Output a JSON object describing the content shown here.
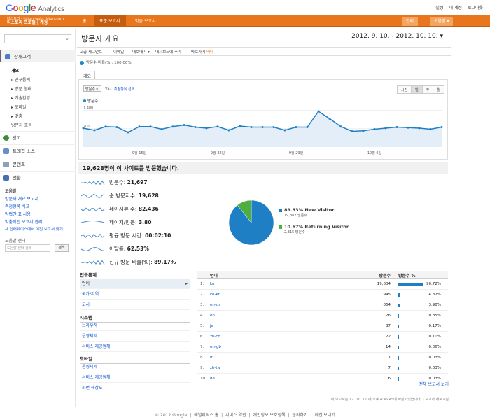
{
  "app": {
    "logo_google": "Google",
    "logo_analytics": "Analytics",
    "top_links": [
      "설정",
      "내 계정",
      "로그아웃"
    ]
  },
  "nav": {
    "account_line1": "티스토리 - tistory-abbi.tistory.com",
    "account_line2": "티스토리 프로필 | 계정",
    "tabs": [
      "홈",
      "표준 보고서",
      "맞춤 보고서"
    ],
    "right_buttons": [
      "관리",
      "도움말 ▾"
    ]
  },
  "sidebar": {
    "search_placeholder": "",
    "sections": [
      {
        "label": "잠재고객",
        "icon": "audience-icon"
      },
      {
        "label": "광고",
        "icon": "advertising-icon"
      },
      {
        "label": "트래픽 소스",
        "icon": "traffic-icon"
      },
      {
        "label": "콘텐츠",
        "icon": "content-icon"
      },
      {
        "label": "전환",
        "icon": "conversion-icon"
      }
    ],
    "audience_sub": [
      "개요",
      "▸ 인구통계",
      "▸ 방문 형태",
      "▸ 기술환경",
      "▸ 모바일",
      "▸ 맞춤",
      "방문자 흐름"
    ],
    "help_title": "도움말",
    "help_links": [
      "방문자 개요 보고서",
      "측정항목 비교",
      "방법안 표 사용",
      "맞춤적인 보고서 관리",
      "새 인터페이스에서 이전 보고서 찾기"
    ],
    "help_center": "도움말 센터",
    "help_search_placeholder": "도움말 센터 검색",
    "help_search_btn": "검색"
  },
  "main": {
    "title": "방문자 개요",
    "date_range": "2012. 9. 10. - 2012. 10. 10.",
    "toolbar": [
      "고급 세그먼트",
      "이메일",
      "내보내기 ▾",
      "대시보드에 추가",
      "바로가기"
    ],
    "toolbar_beta": "베타",
    "segment": "방문수 비율(%): 100.00%",
    "tab": "개요",
    "metric_select": "방문수 ▾",
    "vs": "VS.",
    "add_metric": "측정항목 선택",
    "time_buttons": [
      "시간",
      "일",
      "주",
      "월"
    ],
    "chart_legend": "방문수"
  },
  "chart_data": {
    "type": "area",
    "series": [
      {
        "name": "방문수",
        "values": [
          720,
          640,
          780,
          760,
          560,
          780,
          780,
          680,
          780,
          840,
          760,
          720,
          780,
          640,
          800,
          760,
          760,
          760,
          640,
          760,
          760,
          1360,
          1080,
          780,
          600,
          620,
          680,
          720,
          760,
          740,
          720,
          680,
          760
        ]
      }
    ],
    "y_ticks": [
      "1,400",
      "700"
    ],
    "x_ticks": [
      "9월 15일",
      "9월 22일",
      "9월 29일",
      "10월 6일"
    ],
    "ylim": [
      0,
      1600
    ]
  },
  "summary": {
    "headline": "19,628명이 이 사이트를 방문했습니다.",
    "stats": [
      {
        "label": "방문수:",
        "value": "21,697"
      },
      {
        "label": "순 방문자수:",
        "value": "19,628"
      },
      {
        "label": "페이지뷰 수:",
        "value": "82,436"
      },
      {
        "label": "페이지/방문:",
        "value": "3.80"
      },
      {
        "label": "평균 방문 시간:",
        "value": "00:02:10"
      },
      {
        "label": "이탈률:",
        "value": "62.53%"
      },
      {
        "label": "신규 방문 비율(%):",
        "value": "89.17%"
      }
    ]
  },
  "pie": {
    "slices": [
      {
        "name": "New Visitor",
        "pct": 89.33,
        "label": "89.33% New Visitor",
        "sub": "19,382 방문수",
        "color": "#1f7fc5"
      },
      {
        "name": "Returning Visitor",
        "pct": 10.67,
        "label": "10.67% Returning Visitor",
        "sub": "2,315 방문수",
        "color": "#4daf3f"
      }
    ]
  },
  "left_table": {
    "groups": [
      {
        "title": "인구통계",
        "items": [
          "언어",
          "국가/지역",
          "도시"
        ]
      },
      {
        "title": "시스템",
        "items": [
          "브라우저",
          "운영체제",
          "서비스 제공업체"
        ]
      },
      {
        "title": "모바일",
        "items": [
          "운영체제",
          "서비스 제공업체",
          "화면 해상도"
        ]
      }
    ]
  },
  "right_table": {
    "headers": [
      "언어",
      "방문수",
      "방문수 %"
    ],
    "rows": [
      {
        "n": "1.",
        "lang": "ko",
        "count": "19,604",
        "pct": "90.72%",
        "frac": 0.9072
      },
      {
        "n": "2.",
        "lang": "ko-kr",
        "count": "945",
        "pct": "4.37%",
        "frac": 0.0437
      },
      {
        "n": "3.",
        "lang": "en-us",
        "count": "864",
        "pct": "3.98%",
        "frac": 0.0398
      },
      {
        "n": "4.",
        "lang": "en",
        "count": "76",
        "pct": "0.35%",
        "frac": 0.0035
      },
      {
        "n": "5.",
        "lang": "ja",
        "count": "37",
        "pct": "0.17%",
        "frac": 0.0017
      },
      {
        "n": "6.",
        "lang": "zh-cn",
        "count": "22",
        "pct": "0.10%",
        "frac": 0.001
      },
      {
        "n": "7.",
        "lang": "en-gb",
        "count": "14",
        "pct": "0.06%",
        "frac": 0.0006
      },
      {
        "n": "8.",
        "lang": "it",
        "count": "7",
        "pct": "0.03%",
        "frac": 0.0003
      },
      {
        "n": "9.",
        "lang": "zh-tw",
        "count": "7",
        "pct": "0.03%",
        "frac": 0.0003
      },
      {
        "n": "10.",
        "lang": "de",
        "count": "6",
        "pct": "0.03%",
        "frac": 0.0003
      }
    ],
    "full_report": "전체 보고서 보기",
    "last_updated": "이 보고서는 12. 10. 11.에 오후 4:45:45에 작성되었습니다. - 보고서 새로고침"
  },
  "footer": {
    "copyright": "© 2012 Google",
    "links": [
      "애널리틱스 홈",
      "서비스 약관",
      "개인정보 보호정책",
      "문의하기",
      "의견 보내기"
    ]
  }
}
